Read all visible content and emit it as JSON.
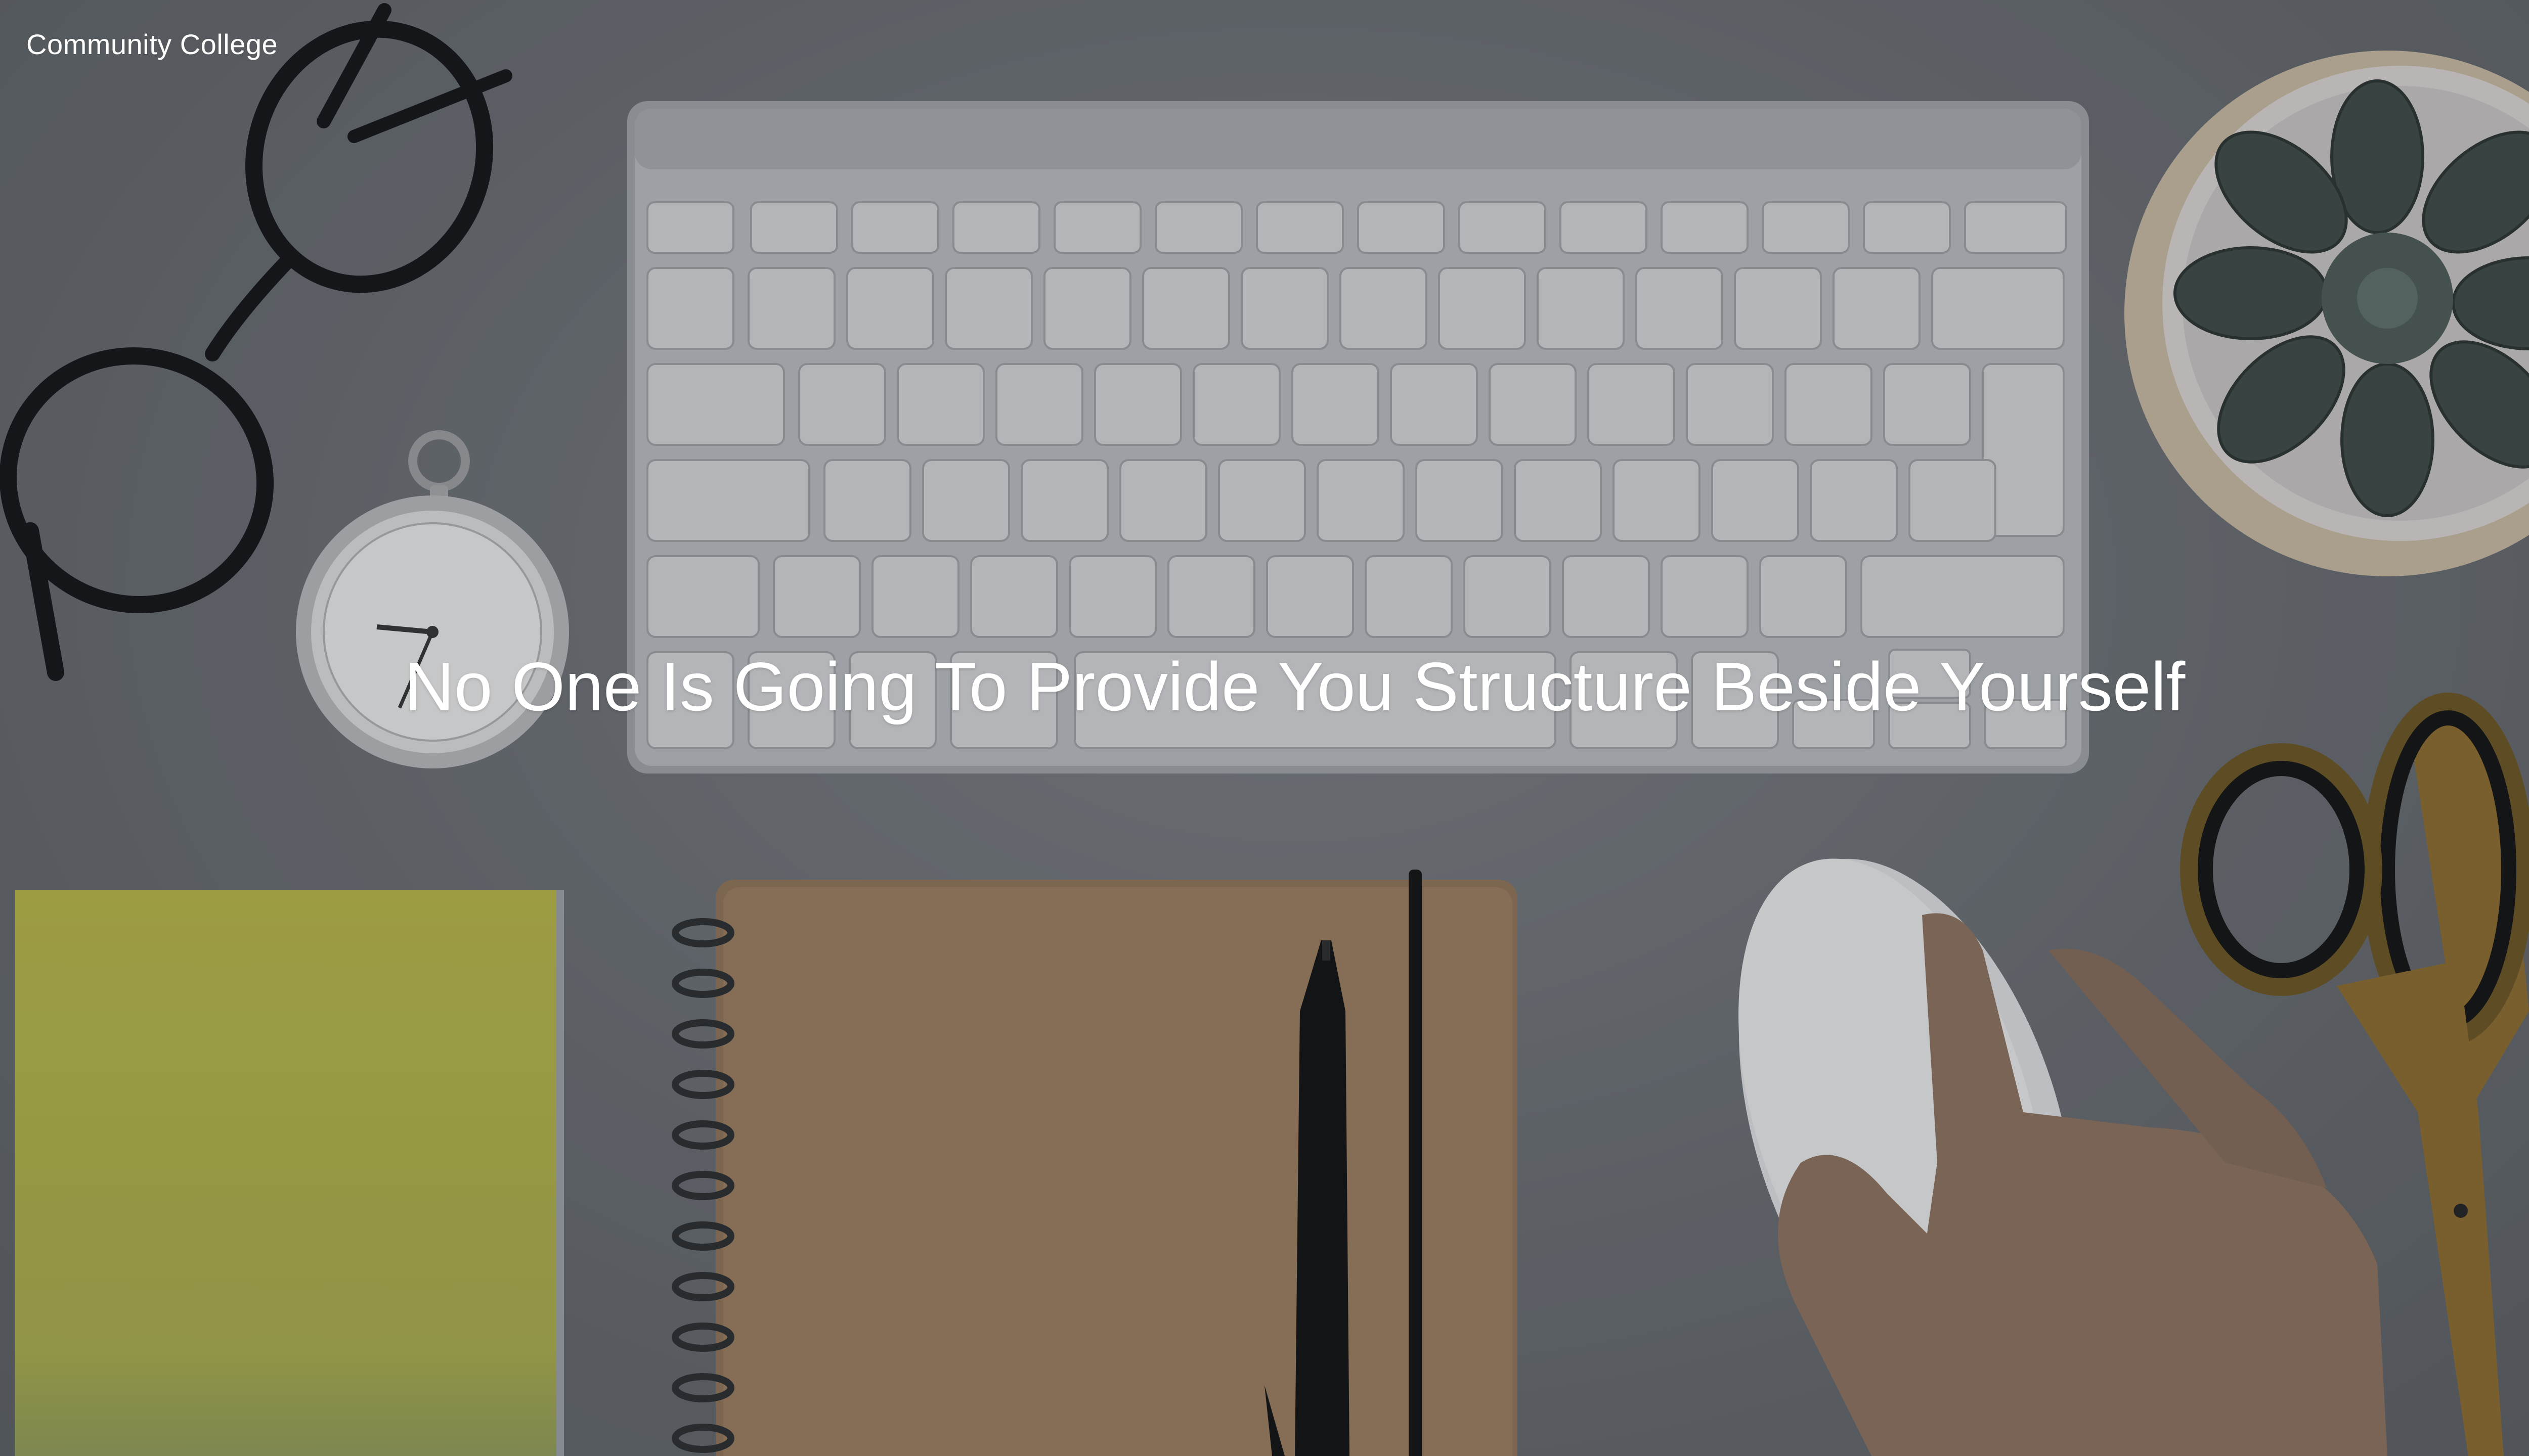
{
  "site": {
    "title": "Community College"
  },
  "hero": {
    "headline": "No One Is Going To Provide You Structure Beside Yourself"
  },
  "colors": {
    "background": "#6b6f73",
    "text": "#ffffff"
  },
  "photo": {
    "objects": [
      "glasses",
      "pocket-watch",
      "keyboard",
      "succulent-plant",
      "yellow-notebook",
      "kraft-notebook",
      "pen",
      "mouse",
      "hand",
      "scissors"
    ]
  }
}
